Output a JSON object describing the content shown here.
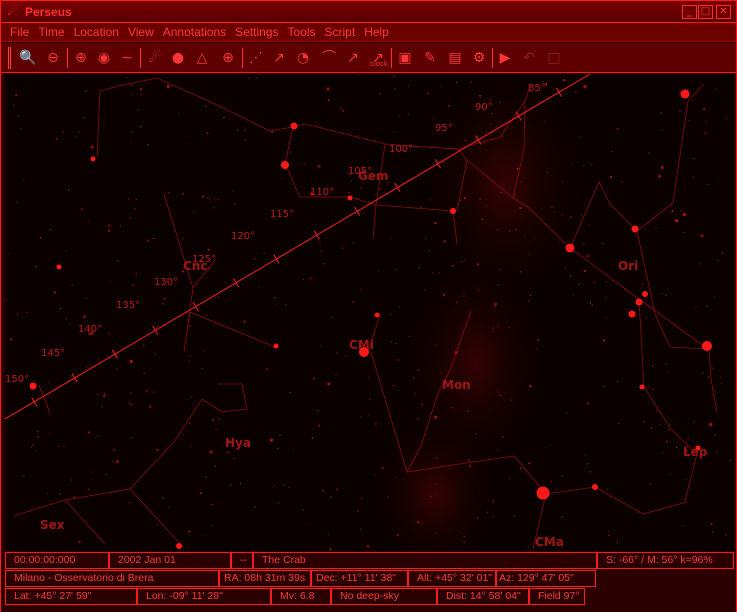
{
  "window": {
    "title": "Perseus"
  },
  "menu": [
    "File",
    "Time",
    "Location",
    "View",
    "Annotations",
    "Settings",
    "Tools",
    "Script",
    "Help"
  ],
  "toolbar": {
    "clock_caption": "clock"
  },
  "sky": {
    "constellations": {
      "gem": "Gem",
      "cnc": "Cnc",
      "ori": "Ori",
      "cmi": "CMi",
      "mon": "Mon",
      "hya": "Hya",
      "lep": "Lep",
      "sex": "Sex",
      "cma": "CMa"
    },
    "ecliptic_ticks": [
      "85°",
      "90°",
      "95°",
      "100°",
      "105°",
      "110°",
      "115°",
      "120°",
      "125°",
      "130°",
      "135°",
      "140°",
      "145°",
      "150°"
    ]
  },
  "status": {
    "timer": "00:00:00:000",
    "date": "2002 Jan 01",
    "separator": "--",
    "object": "The Crab",
    "limits": "S: -66° / M: 56° k=96%",
    "site": "Milano - Osservatorio di Brera",
    "ra": "RA: 08h 31m 39s",
    "dec": "Dec: +11° 11' 38\"",
    "alt": "Alt: +45° 32' 01\"",
    "az": "Az: 129° 47' 05\"",
    "lat": "Lat: +45° 27' 59\"",
    "lon": "Lon: -09° 11' 28\"",
    "mv": "Mv:  6.8",
    "deep_sky": "No deep-sky",
    "dist": "Dist: 14° 58' 04\"",
    "field": "Field 97°"
  },
  "colors": {
    "accent": "#ff1a1a",
    "sky": "#0a0000",
    "chrome": "#5e0000"
  }
}
